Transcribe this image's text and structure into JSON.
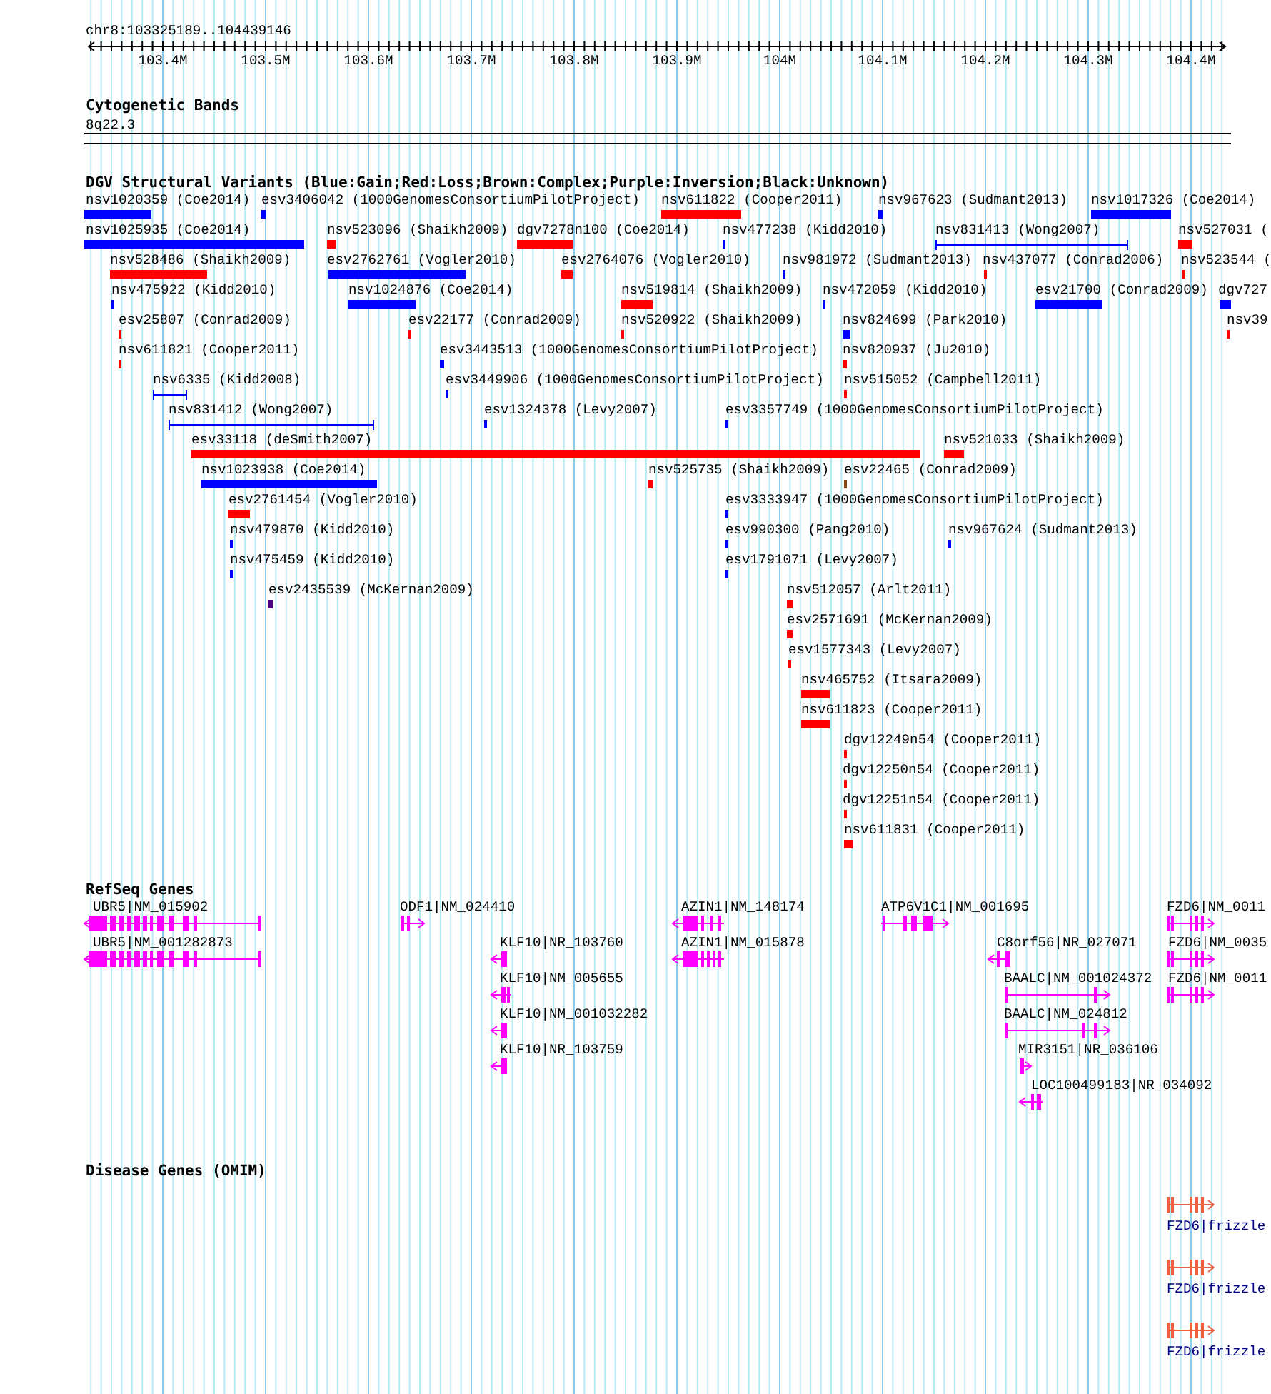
{
  "position": "chr8:103325189..104439146",
  "ruler": {
    "ticks": [
      "103.4M",
      "103.5M",
      "103.6M",
      "103.7M",
      "103.8M",
      "103.9M",
      "104M",
      "104.1M",
      "104.2M",
      "104.3M",
      "104.4M"
    ]
  },
  "cytogenetic_bands": {
    "title": "Cytogenetic Bands",
    "band": "8q22.3"
  },
  "dgv_track": {
    "title": "DGV Structural Variants (Blue:Gain;Red:Loss;Brown:Complex;Purple:Inversion;Black:Unknown)",
    "variants": [
      {
        "label": "nsv1020359 (Coe2014)",
        "kind": "bar",
        "color": "#0000ff"
      },
      {
        "label": "esv3406042 (1000GenomesConsortiumPilotProject)",
        "kind": "bar",
        "color": "#0000ff"
      },
      {
        "label": "nsv611822 (Cooper2011)",
        "kind": "bar",
        "color": "#ff0000"
      },
      {
        "label": "nsv967623 (Sudmant2013)",
        "kind": "bar",
        "color": "#0000ff"
      },
      {
        "label": "nsv1017326 (Coe2014)",
        "kind": "bar",
        "color": "#0000ff"
      },
      {
        "label": "nsv1025935 (Coe2014)",
        "kind": "bar",
        "color": "#0000ff"
      },
      {
        "label": "nsv523096 (Shaikh2009)",
        "kind": "bar",
        "color": "#ff0000"
      },
      {
        "label": "dgv7278n100 (Coe2014)",
        "kind": "bar",
        "color": "#ff0000"
      },
      {
        "label": "nsv477238 (Kidd2010)",
        "kind": "bar",
        "color": "#0000ff"
      },
      {
        "label": "nsv831413 (Wong2007)",
        "kind": "span",
        "color": "#0000ff"
      },
      {
        "label": "nsv527031 (",
        "kind": "bar",
        "color": "#ff0000"
      },
      {
        "label": "nsv528486 (Shaikh2009)",
        "kind": "bar",
        "color": "#ff0000"
      },
      {
        "label": "esv2762761 (Vogler2010)",
        "kind": "bar",
        "color": "#0000ff"
      },
      {
        "label": "esv2764076 (Vogler2010)",
        "kind": "bar",
        "color": "#ff0000"
      },
      {
        "label": "nsv981972 (Sudmant2013)",
        "kind": "bar",
        "color": "#0000ff"
      },
      {
        "label": "nsv437077 (Conrad2006)",
        "kind": "bar",
        "color": "#ff0000"
      },
      {
        "label": "nsv523544 (",
        "kind": "bar",
        "color": "#ff0000"
      },
      {
        "label": "nsv475922 (Kidd2010)",
        "kind": "bar",
        "color": "#0000ff"
      },
      {
        "label": "nsv1024876 (Coe2014)",
        "kind": "bar",
        "color": "#0000ff"
      },
      {
        "label": "nsv519814 (Shaikh2009)",
        "kind": "bar",
        "color": "#ff0000"
      },
      {
        "label": "nsv472059 (Kidd2010)",
        "kind": "bar",
        "color": "#0000ff"
      },
      {
        "label": "esv21700 (Conrad2009)",
        "kind": "bar",
        "color": "#0000ff"
      },
      {
        "label": "dgv727",
        "kind": "bar",
        "color": "#0000ff"
      },
      {
        "label": "esv25807 (Conrad2009)",
        "kind": "bar",
        "color": "#ff0000"
      },
      {
        "label": "esv22177 (Conrad2009)",
        "kind": "bar",
        "color": "#ff0000"
      },
      {
        "label": "nsv520922 (Shaikh2009)",
        "kind": "bar",
        "color": "#ff0000"
      },
      {
        "label": "nsv824699 (Park2010)",
        "kind": "bar",
        "color": "#0000ff"
      },
      {
        "label": "nsv39",
        "kind": "bar",
        "color": "#ff0000"
      },
      {
        "label": "nsv611821 (Cooper2011)",
        "kind": "bar",
        "color": "#ff0000"
      },
      {
        "label": "esv3443513 (1000GenomesConsortiumPilotProject)",
        "kind": "bar",
        "color": "#0000ff"
      },
      {
        "label": "nsv820937 (Ju2010)",
        "kind": "bar",
        "color": "#ff0000"
      },
      {
        "label": "nsv6335 (Kidd2008)",
        "kind": "span",
        "color": "#0000ff"
      },
      {
        "label": "esv3449906 (1000GenomesConsortiumPilotProject)",
        "kind": "bar",
        "color": "#0000ff"
      },
      {
        "label": "nsv515052 (Campbell2011)",
        "kind": "bar",
        "color": "#ff0000"
      },
      {
        "label": "nsv831412 (Wong2007)",
        "kind": "span",
        "color": "#0000ff"
      },
      {
        "label": "esv1324378 (Levy2007)",
        "kind": "bar",
        "color": "#0000ff"
      },
      {
        "label": "esv3357749 (1000GenomesConsortiumPilotProject)",
        "kind": "bar",
        "color": "#0000ff"
      },
      {
        "label": "esv33118 (deSmith2007)",
        "kind": "bar",
        "color": "#ff0000"
      },
      {
        "label": "nsv521033 (Shaikh2009)",
        "kind": "bar",
        "color": "#ff0000"
      },
      {
        "label": "nsv1023938 (Coe2014)",
        "kind": "bar",
        "color": "#0000ff"
      },
      {
        "label": "nsv525735 (Shaikh2009)",
        "kind": "bar",
        "color": "#ff0000"
      },
      {
        "label": "esv22465 (Conrad2009)",
        "kind": "bar",
        "color": "#8b4513"
      },
      {
        "label": "esv2761454 (Vogler2010)",
        "kind": "bar",
        "color": "#ff0000"
      },
      {
        "label": "esv3333947 (1000GenomesConsortiumPilotProject)",
        "kind": "bar",
        "color": "#0000ff"
      },
      {
        "label": "nsv479870 (Kidd2010)",
        "kind": "bar",
        "color": "#0000ff"
      },
      {
        "label": "esv990300 (Pang2010)",
        "kind": "bar",
        "color": "#0000ff"
      },
      {
        "label": "nsv967624 (Sudmant2013)",
        "kind": "bar",
        "color": "#0000ff"
      },
      {
        "label": "nsv475459 (Kidd2010)",
        "kind": "bar",
        "color": "#0000ff"
      },
      {
        "label": "esv1791071 (Levy2007)",
        "kind": "bar",
        "color": "#0000ff"
      },
      {
        "label": "esv2435539 (McKernan2009)",
        "kind": "bar",
        "color": "#4b0082"
      },
      {
        "label": "nsv512057 (Arlt2011)",
        "kind": "bar",
        "color": "#ff0000"
      },
      {
        "label": "esv2571691 (McKernan2009)",
        "kind": "bar",
        "color": "#ff0000"
      },
      {
        "label": "esv1577343 (Levy2007)",
        "kind": "bar",
        "color": "#ff0000"
      },
      {
        "label": "nsv465752 (Itsara2009)",
        "kind": "bar",
        "color": "#ff0000"
      },
      {
        "label": "nsv611823 (Cooper2011)",
        "kind": "bar",
        "color": "#ff0000"
      },
      {
        "label": "dgv12249n54 (Cooper2011)",
        "kind": "bar",
        "color": "#ff0000"
      },
      {
        "label": "dgv12250n54 (Cooper2011)",
        "kind": "bar",
        "color": "#ff0000"
      },
      {
        "label": "dgv12251n54 (Cooper2011)",
        "kind": "bar",
        "color": "#ff0000"
      },
      {
        "label": "nsv611831 (Cooper2011)",
        "kind": "bar",
        "color": "#ff0000"
      }
    ]
  },
  "refseq_track": {
    "title": "RefSeq Genes",
    "genes": [
      {
        "label": "UBR5|NM_015902",
        "reverse": true
      },
      {
        "label": "ODF1|NM_024410",
        "reverse": false
      },
      {
        "label": "AZIN1|NM_148174",
        "reverse": true
      },
      {
        "label": "ATP6V1C1|NM_001695",
        "reverse": false
      },
      {
        "label": "FZD6|NM_0011",
        "reverse": false
      },
      {
        "label": "UBR5|NM_001282873",
        "reverse": true
      },
      {
        "label": "KLF10|NR_103760",
        "reverse": true
      },
      {
        "label": "AZIN1|NM_015878",
        "reverse": true
      },
      {
        "label": "C8orf56|NR_027071",
        "reverse": true
      },
      {
        "label": "FZD6|NM_0035",
        "reverse": false
      },
      {
        "label": "KLF10|NM_005655",
        "reverse": true
      },
      {
        "label": "BAALC|NM_001024372",
        "reverse": false
      },
      {
        "label": "FZD6|NM_0011",
        "reverse": false
      },
      {
        "label": "KLF10|NM_001032282",
        "reverse": true
      },
      {
        "label": "BAALC|NM_024812",
        "reverse": false
      },
      {
        "label": "KLF10|NR_103759",
        "reverse": true
      },
      {
        "label": "MIR3151|NR_036106",
        "reverse": false
      },
      {
        "label": "LOC100499183|NR_034092",
        "reverse": true
      }
    ]
  },
  "disease_track": {
    "title": "Disease Genes (OMIM)",
    "genes": [
      {
        "label": "FZD6|frizzle",
        "reverse": false
      },
      {
        "label": "FZD6|frizzle",
        "reverse": false
      },
      {
        "label": "FZD6|frizzle",
        "reverse": false
      }
    ]
  }
}
